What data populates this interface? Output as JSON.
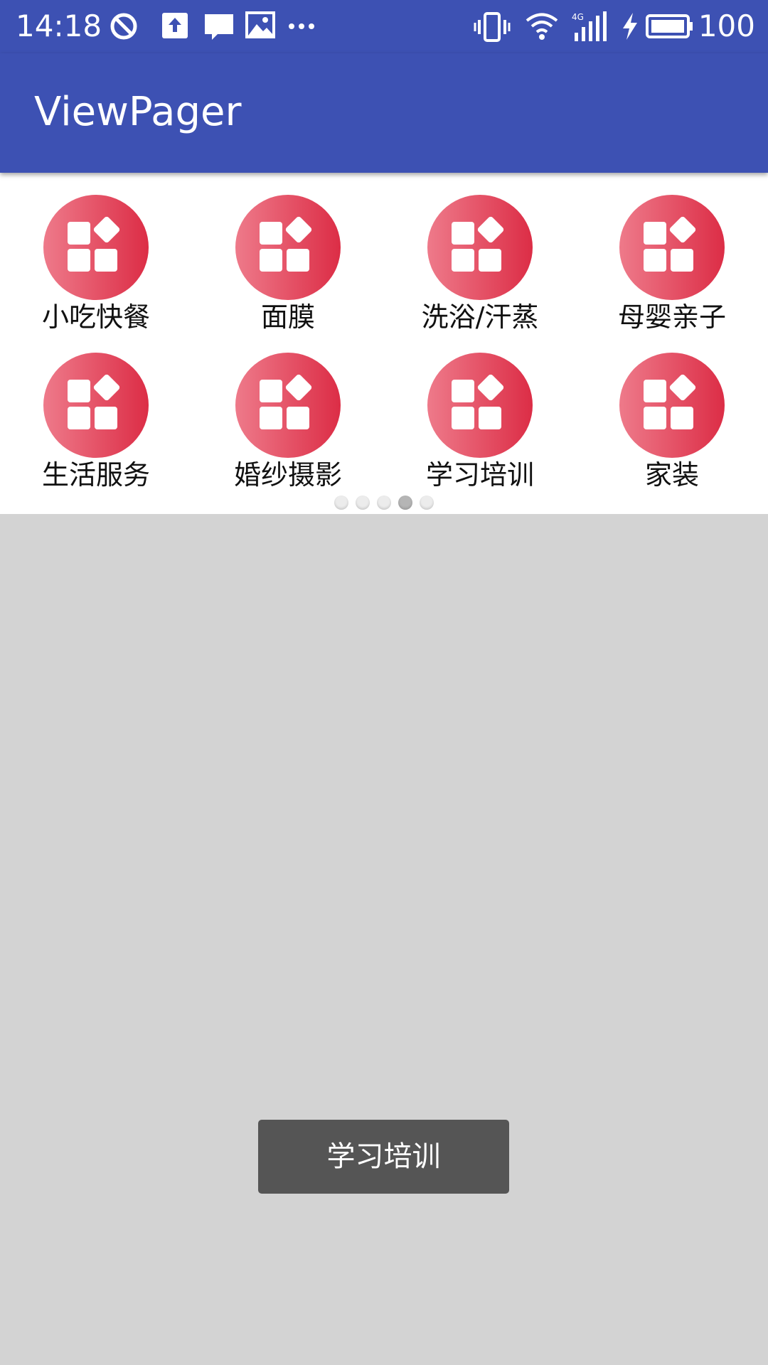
{
  "status_bar": {
    "time": "14:18",
    "battery_level": "100",
    "icons": [
      "do-not-disturb-icon",
      "upload-icon",
      "message-icon",
      "image-icon",
      "more-icon",
      "vibrate-icon",
      "wifi-icon",
      "signal-4g-icon",
      "charging-icon",
      "battery-icon"
    ]
  },
  "app_bar": {
    "title": "ViewPager"
  },
  "grid": {
    "icon": "category-grid-icon",
    "colors": {
      "gradient_start": "#ee7a8a",
      "gradient_end": "#dc2d46"
    },
    "items": [
      {
        "label": "小吃快餐"
      },
      {
        "label": "面膜"
      },
      {
        "label": "洗浴/汗蒸"
      },
      {
        "label": "母婴亲子"
      },
      {
        "label": "生活服务"
      },
      {
        "label": "婚纱摄影"
      },
      {
        "label": "学习培训"
      },
      {
        "label": "家装"
      }
    ]
  },
  "pager_indicator": {
    "pages": 5,
    "current": 4
  },
  "toast": {
    "text": "学习培训"
  },
  "colors": {
    "primary": "#3d51b3",
    "background": "#d3d3d3",
    "toast": "#555555"
  }
}
